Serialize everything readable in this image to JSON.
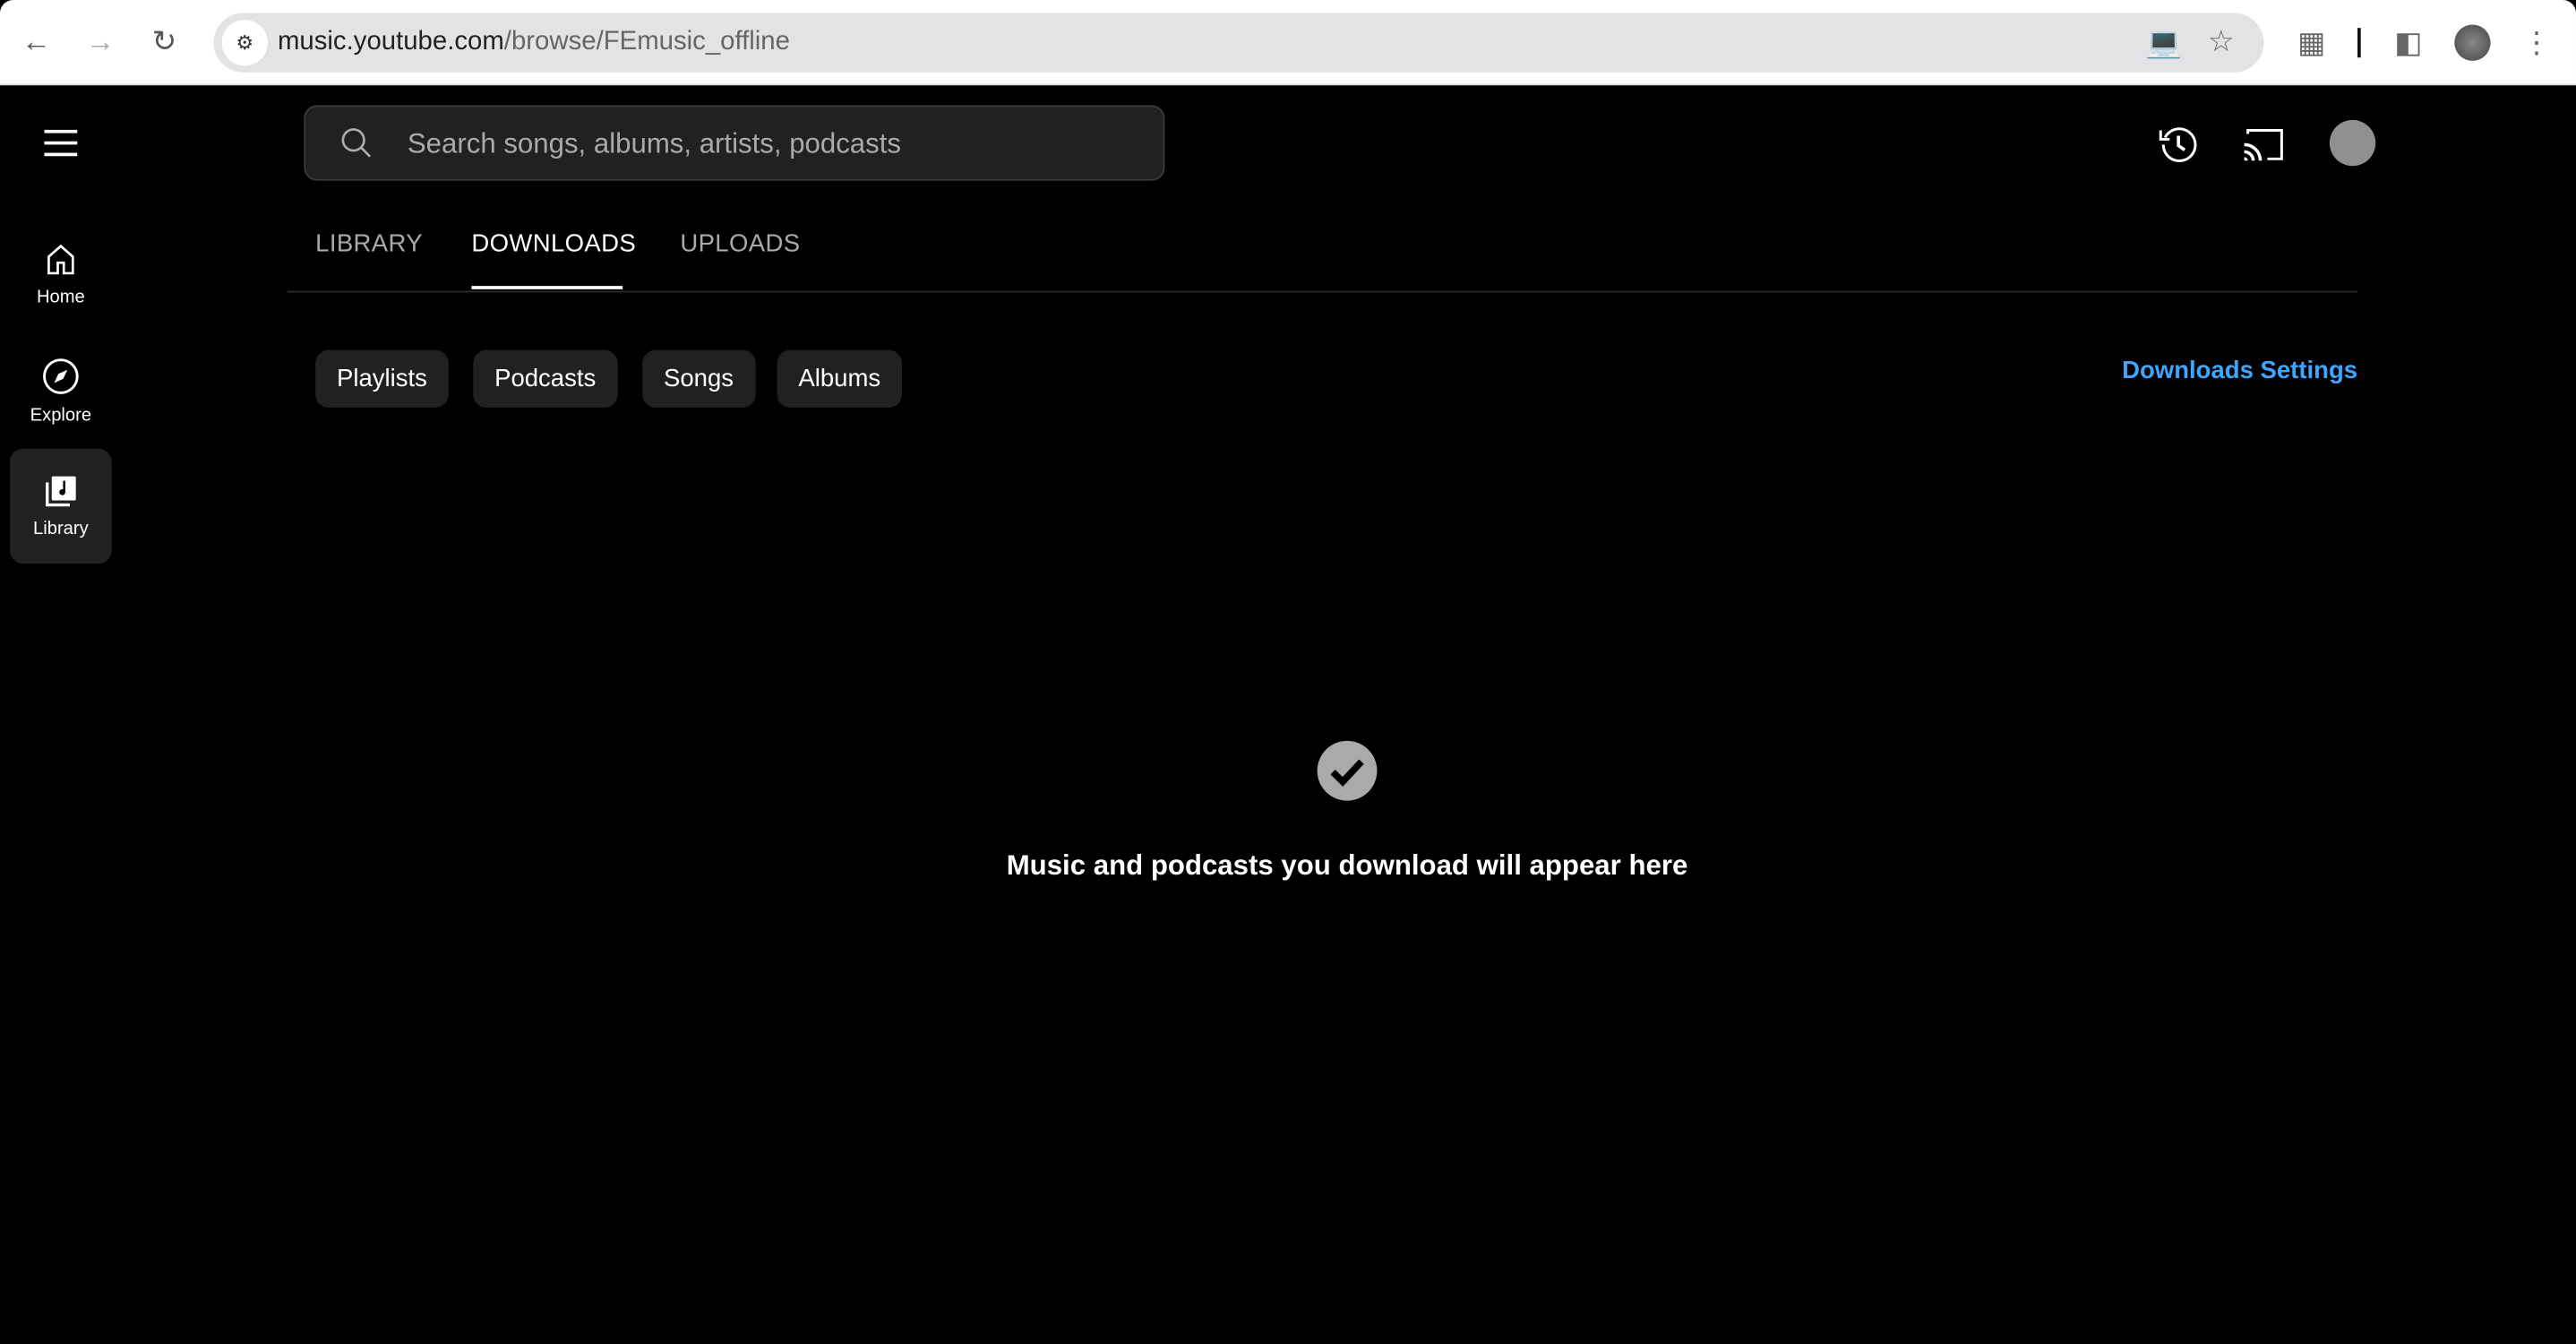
{
  "browser": {
    "url_host": "music.youtube.com",
    "url_path": "/browse/FEmusic_offline"
  },
  "sidebar": {
    "items": [
      {
        "label": "Home",
        "icon": "home-icon"
      },
      {
        "label": "Explore",
        "icon": "compass-icon"
      },
      {
        "label": "Library",
        "icon": "library-icon",
        "active": true
      }
    ]
  },
  "search": {
    "placeholder": "Search songs, albums, artists, podcasts"
  },
  "tabs": [
    {
      "label": "LIBRARY"
    },
    {
      "label": "DOWNLOADS",
      "active": true
    },
    {
      "label": "UPLOADS"
    }
  ],
  "chips": [
    "Playlists",
    "Podcasts",
    "Songs",
    "Albums"
  ],
  "downloads_settings": "Downloads Settings",
  "empty_state": {
    "icon": "check-circle-icon",
    "message": "Music and podcasts you download will appear here"
  },
  "colors": {
    "accent_link": "#3ea6ff",
    "background": "#000000",
    "chip_bg": "#212121"
  }
}
